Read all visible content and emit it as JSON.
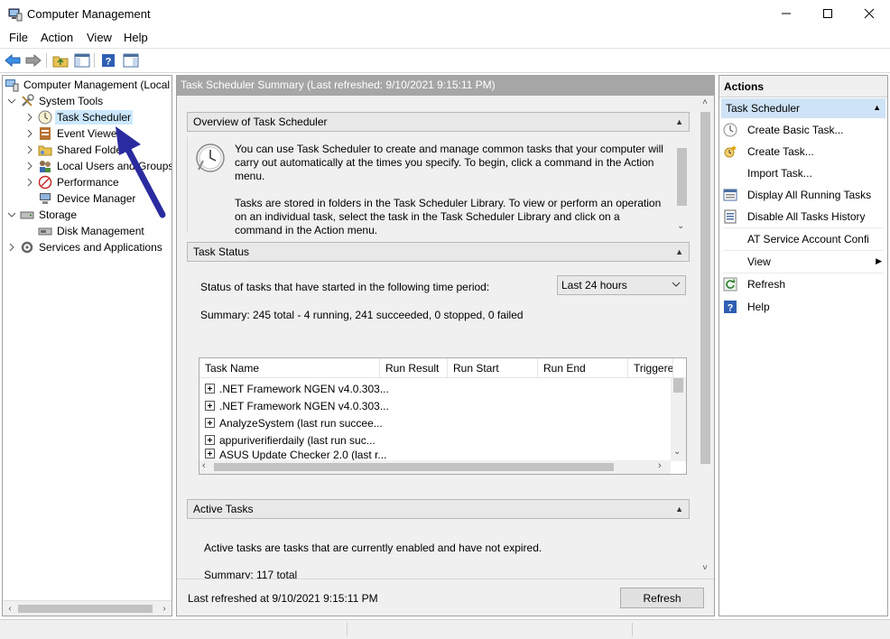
{
  "window": {
    "title": "Computer Management"
  },
  "menu": [
    "File",
    "Action",
    "View",
    "Help"
  ],
  "tree": {
    "root": "Computer Management (Local",
    "items": [
      "System Tools",
      "Task Scheduler",
      "Event Viewer",
      "Shared Folders",
      "Local Users and Groups",
      "Performance",
      "Device Manager",
      "Storage",
      "Disk Management",
      "Services and Applications"
    ]
  },
  "center": {
    "header": "Task Scheduler Summary (Last refreshed: 9/10/2021 9:15:11 PM)",
    "overview": {
      "title": "Overview of Task Scheduler",
      "para1": "You can use Task Scheduler to create and manage common tasks that your computer will carry out automatically at the times you specify. To begin, click a command in the Action menu.",
      "para2": "Tasks are stored in folders in the Task Scheduler Library. To view or perform an operation on an individual task, select the task in the Task Scheduler Library and click on a command in the Action menu."
    },
    "task_status": {
      "title": "Task Status",
      "period_label": "Status of tasks that have started in the following time period:",
      "period_value": "Last 24 hours",
      "summary": "Summary: 245 total - 4 running, 241 succeeded, 0 stopped, 0 failed",
      "columns": [
        "Task Name",
        "Run Result",
        "Run Start",
        "Run End",
        "Triggered By"
      ],
      "rows": [
        ".NET Framework NGEN v4.0.303...",
        ".NET Framework NGEN v4.0.303...",
        "AnalyzeSystem (last run succee...",
        "appuriverifierdaily (last run suc...",
        "ASUS Update Checker 2.0 (last r..."
      ]
    },
    "active_tasks": {
      "title": "Active Tasks",
      "description": "Active tasks are tasks that are currently enabled and have not expired.",
      "summary": "Summary: 117 total"
    },
    "footer": {
      "last_refreshed": "Last refreshed at 9/10/2021 9:15:11 PM",
      "refresh_button": "Refresh"
    }
  },
  "actions": {
    "header": "Actions",
    "section": "Task Scheduler",
    "items": [
      "Create Basic Task...",
      "Create Task...",
      "Import Task...",
      "Display All Running Tasks",
      "Disable All Tasks History",
      "AT Service Account Configuration",
      "View",
      "Refresh",
      "Help"
    ]
  },
  "colors": {
    "selection": "#cce8ff",
    "center_header_bg": "#a6a6a6",
    "actions_section_bg": "#cfe3f7",
    "annotation_arrow": "#2b2ba0"
  },
  "icons": {
    "window": "computer-management-icon",
    "back": "back-arrow-icon",
    "forward": "forward-arrow-icon"
  }
}
